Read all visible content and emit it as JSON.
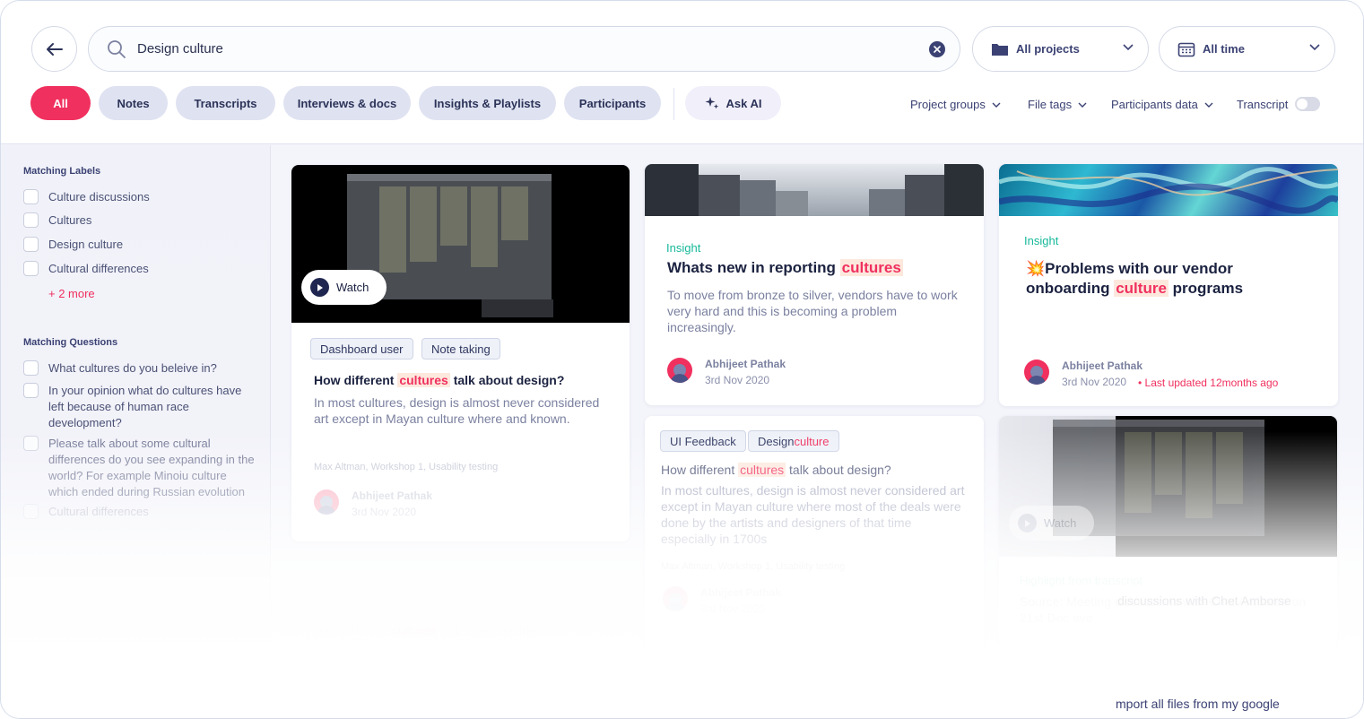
{
  "search": {
    "query": "Design culture"
  },
  "filters": {
    "projects": "All projects",
    "time": "All time"
  },
  "tabs": [
    "All",
    "Notes",
    "Transcripts",
    "Interviews & docs",
    "Insights & Playlists",
    "Participants"
  ],
  "ask_ai": "Ask AI",
  "dropdown_filters": [
    "Project groups",
    "File tags",
    "Participants data",
    "Transcript"
  ],
  "sidebar": {
    "labels_title": "Matching Labels",
    "labels": [
      "Culture discussions",
      "Cultures",
      "Design culture",
      "Cultural differences"
    ],
    "more": "+ 2 more",
    "questions_title": "Matching Questions",
    "questions": [
      "What cultures do you beleive in?",
      "In your opinion what do cultures have left because of human race development?",
      "Please talk about some cultural differences do you see expanding in the world? For example Minoiu culture which ended during Russian evolution",
      "Cultural differences"
    ]
  },
  "cards": {
    "c1": {
      "watch": "Watch",
      "tags": [
        "Dashboard user",
        "Note taking"
      ],
      "title_pre": "How different ",
      "title_hl": "cultures",
      "title_post": " talk about design?",
      "body": "In most cultures, design is almost never considered art except in Mayan culture where and known.",
      "meta": "Max Altman, Workshop 1, Usability testing",
      "author": "Abhijeet Pathak",
      "date": "3rd Nov 2020"
    },
    "c2": {
      "type": "Insight",
      "title_pre": "Whats new in reporting ",
      "title_hl": "cultures",
      "body": "To move from bronze to silver, vendors have to work very hard and this is becoming a problem increasingly.",
      "author": "Abhijeet Pathak",
      "date": "3rd Nov 2020"
    },
    "c3": {
      "type": "Insight",
      "emoji": "💥",
      "title_pre": "Problems with our vendor onboarding ",
      "title_hl": "culture",
      "title_post": " programs",
      "author": "Abhijeet Pathak",
      "date": "3rd Nov 2020",
      "updated": "Last updated 12months ago"
    },
    "c4": {
      "tag1": "UI Feedback",
      "tag2_pre": "Design ",
      "tag2_hl": "culture",
      "title_pre": "How different ",
      "title_hl": "cultures",
      "title_post": " talk about design?",
      "body": "In most cultures, design is almost never considered art except in Mayan culture where most of the deals were done by the artists and designers of that time especially in 1700s",
      "meta": "Max Altman, Workshop 1, Usability testing",
      "author": "Abhijeet Pathak",
      "date": "3rd Nov 2020"
    },
    "c5": {
      "watch": "Watch",
      "label": "Highlight from transcript",
      "title": "Source: Meeting discussions with Chet Amborse on 21st Dec ave",
      "ghost_title": "discussions with Chet Amborse"
    },
    "c6": {
      "title_pre": "How different ",
      "title_hl": "cultures",
      "title_post": " talk about design?"
    },
    "footer_snippet": "mport all files from my google"
  }
}
